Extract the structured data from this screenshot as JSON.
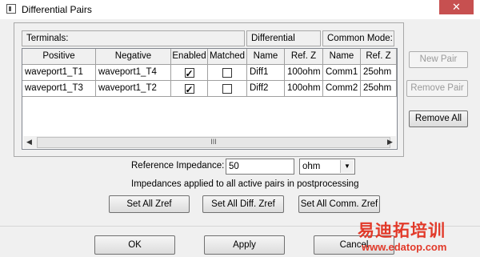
{
  "window": {
    "title": "Differential Pairs",
    "close_glyph": "✕"
  },
  "headers": {
    "terminals": "Terminals:",
    "differential_mode": "Differential Mode:",
    "common_mode": "Common Mode:"
  },
  "columns": {
    "positive": "Positive",
    "negative": "Negative",
    "enabled": "Enabled",
    "matched": "Matched",
    "diff_name": "Name",
    "diff_refz": "Ref. Z",
    "comm_name": "Name",
    "comm_refz": "Ref. Z"
  },
  "rows": [
    {
      "positive": "waveport1_T1",
      "negative": "waveport1_T4",
      "enabled": true,
      "matched": false,
      "diff_name": "Diff1",
      "diff_refz": "100ohm",
      "comm_name": "Comm1",
      "comm_refz": "25ohm"
    },
    {
      "positive": "waveport1_T3",
      "negative": "waveport1_T2",
      "enabled": true,
      "matched": false,
      "diff_name": "Diff2",
      "diff_refz": "100ohm",
      "comm_name": "Comm2",
      "comm_refz": "25ohm"
    }
  ],
  "scrollbar": {
    "left_arrow": "◀",
    "right_arrow": "▶",
    "grip": "III"
  },
  "side_buttons": {
    "new_pair": "New Pair",
    "remove_pair": "Remove Pair",
    "remove_all": "Remove All"
  },
  "reference": {
    "label": "Reference Impedance:",
    "value": "50",
    "unit": "ohm",
    "note": "Impedances applied to all active pairs in postprocessing"
  },
  "set_buttons": {
    "set_all_zref": "Set All Zref",
    "set_all_diff": "Set All Diff. Zref",
    "set_all_comm": "Set All Comm. Zref"
  },
  "dialog_buttons": {
    "ok": "OK",
    "apply": "Apply",
    "cancel": "Cancel"
  },
  "watermark": {
    "line1": "易迪拓培训",
    "line2": "www.edatop.com"
  }
}
